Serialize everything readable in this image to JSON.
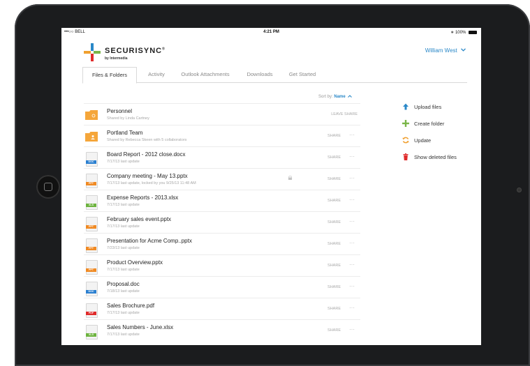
{
  "status_bar": {
    "carrier": "•••○○ BELL",
    "time": "4:21 PM",
    "battery": "100%"
  },
  "brand": {
    "name": "SECURISYNC",
    "mark": "®",
    "by": "by Intermedia"
  },
  "user": {
    "name": "William West"
  },
  "tabs": [
    {
      "label": "Files & Folders",
      "active": true
    },
    {
      "label": "Activity"
    },
    {
      "label": "Outlook Attachments"
    },
    {
      "label": "Downloads"
    },
    {
      "label": "Get Started"
    }
  ],
  "sort": {
    "label": "Sort by:",
    "value": "Name"
  },
  "files": [
    {
      "name": "Personnel",
      "sub": "Shared by Linda Cartney",
      "kind": "folder",
      "action": "LEAVE SHARE"
    },
    {
      "name": "Portland Team",
      "sub": "Shared by Rebecca Skeen with 5 collaborators",
      "kind": "folder-shared",
      "action": "SHARE"
    },
    {
      "name": "Board Report - 2012 close.docx",
      "sub": "7/17/13 last update",
      "kind": "DOC",
      "action": "SHARE"
    },
    {
      "name": "Company meeting - May 13.pptx",
      "sub": "7/17/13 last update, locked by you 9/25/13 11:48 AM",
      "kind": "PPT",
      "action": "SHARE",
      "locked": true
    },
    {
      "name": "Expense Reports - 2013.xlsx",
      "sub": "7/17/13 last update",
      "kind": "XLS",
      "action": "SHARE"
    },
    {
      "name": "February sales event.pptx",
      "sub": "7/17/13 last update",
      "kind": "PPT",
      "action": "SHARE"
    },
    {
      "name": "Presentation for Acme Comp..pptx",
      "sub": "7/23/13 last update",
      "kind": "PPT",
      "action": "SHARE"
    },
    {
      "name": "Product Overview.pptx",
      "sub": "7/17/13 last update",
      "kind": "PPT",
      "action": "SHARE"
    },
    {
      "name": "Proposal.doc",
      "sub": "7/18/13 last update",
      "kind": "DOC",
      "action": "SHARE"
    },
    {
      "name": "Sales Brochure.pdf",
      "sub": "7/17/13 last update",
      "kind": "PDF",
      "action": "SHARE"
    },
    {
      "name": "Sales Numbers - June.xlsx",
      "sub": "7/17/13 last update",
      "kind": "XLS",
      "action": "SHARE"
    }
  ],
  "actions": [
    {
      "label": "Upload files",
      "icon": "upload-arrow-icon",
      "color": "#2a88c8"
    },
    {
      "label": "Create folder",
      "icon": "plus-icon",
      "color": "#7ab648"
    },
    {
      "label": "Update",
      "icon": "refresh-icon",
      "color": "#f0a030"
    },
    {
      "label": "Show deleted files",
      "icon": "trash-icon",
      "color": "#e02b2b"
    }
  ],
  "colors": {
    "accent": "#2a88c8",
    "folder": "#f5a63a",
    "doc": "#2a7fd0",
    "ppt": "#f08a24",
    "xls": "#6db33f",
    "pdf": "#e02b2b"
  }
}
